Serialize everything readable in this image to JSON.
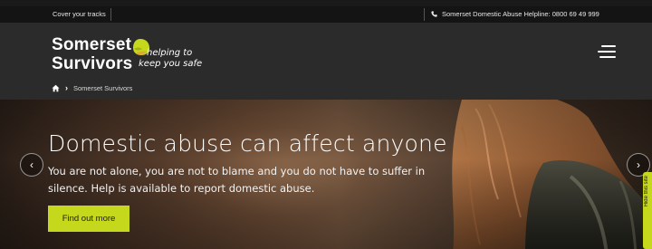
{
  "topbar": {
    "cover_tracks": "Cover your tracks",
    "helpline": "Somerset Domestic Abuse Helpline: 0800 69 49 999"
  },
  "logo": {
    "line1": "Somerset",
    "line2": "Survivors",
    "tagline1": "helping to",
    "tagline2": "keep you safe",
    "accent_color": "#c6d81b"
  },
  "breadcrumb": {
    "current": "Somerset Survivors"
  },
  "hero": {
    "headline": "Domestic abuse can affect anyone",
    "subtext": "You are not alone, you are not to blame and you do not have to suffer in silence. Help is available to report domestic abuse.",
    "cta_label": "Find out more",
    "prev_icon": "‹",
    "next_icon": "›"
  },
  "side_tab": {
    "label": "Hide this site"
  },
  "colors": {
    "accent": "#c6d81b",
    "header_bg": "#2b2b2b",
    "topbar_bg": "#141414"
  }
}
